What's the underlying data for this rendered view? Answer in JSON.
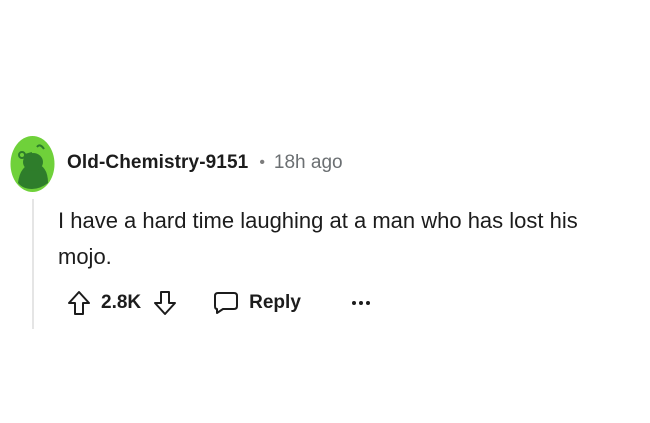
{
  "comment": {
    "author": "Old-Chemistry-9151",
    "separator": "•",
    "timestamp": "18h ago",
    "body": "I have a hard time laughing at a man who has lost his mojo.",
    "vote_count": "2.8K",
    "reply_label": "Reply",
    "more_label": "..."
  },
  "icons": {
    "avatar": "snoo-avatar-icon",
    "upvote": "upvote-arrow-icon",
    "downvote": "downvote-arrow-icon",
    "reply": "speech-bubble-icon",
    "more": "ellipsis-icon"
  },
  "colors": {
    "avatar_background": "#6fd13a",
    "avatar_figure": "#2e7d2b",
    "text": "#1c1c1c",
    "meta_text": "#6b6f72",
    "thread_line": "#e5e5e5"
  }
}
